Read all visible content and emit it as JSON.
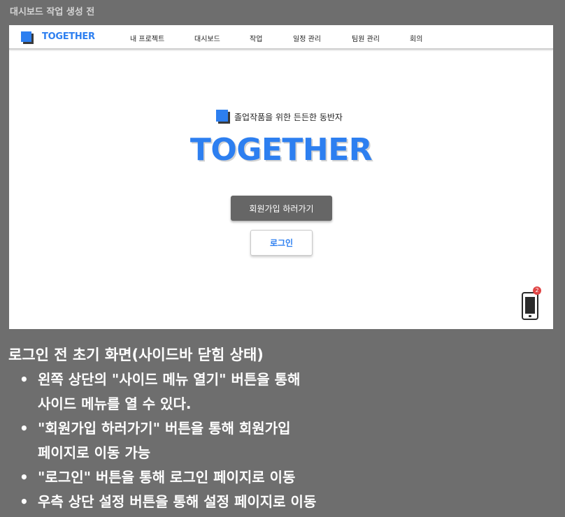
{
  "page_title": "대시보드 작업 생성 전",
  "navbar": {
    "logo": "TOGETHER",
    "items": [
      "내 프로젝트",
      "대시보드",
      "작업",
      "일정 관리",
      "팀원 관리",
      "회의"
    ]
  },
  "hero": {
    "tagline": "졸업작품을 위한 든든한 동반자",
    "logo": "TOGETHER",
    "signup_button": "회원가입 하러가기",
    "login_button": "로그인"
  },
  "phone": {
    "badge": "2"
  },
  "description": {
    "heading": "로그인 전 초기 화면(사이드바 닫힘 상태)",
    "items": [
      [
        "왼쪽 상단의 \"사이드 메뉴 열기\" 버튼을 통해",
        "사이드 메뉴를 열 수 있다."
      ],
      [
        "\"회원가입 하러가기\" 버튼을 통해 회원가입",
        "페이지로 이동 가능"
      ],
      [
        "\"로그인\" 버튼을 통해 로그인 페이지로 이동"
      ],
      [
        "우측 상단 설정 버튼을 통해 설정 페이지로 이동"
      ]
    ]
  },
  "colors": {
    "brand": "#2d7ff0",
    "background": "#6e6e6e",
    "signup_button": "#666666",
    "badge": "#e04545"
  }
}
